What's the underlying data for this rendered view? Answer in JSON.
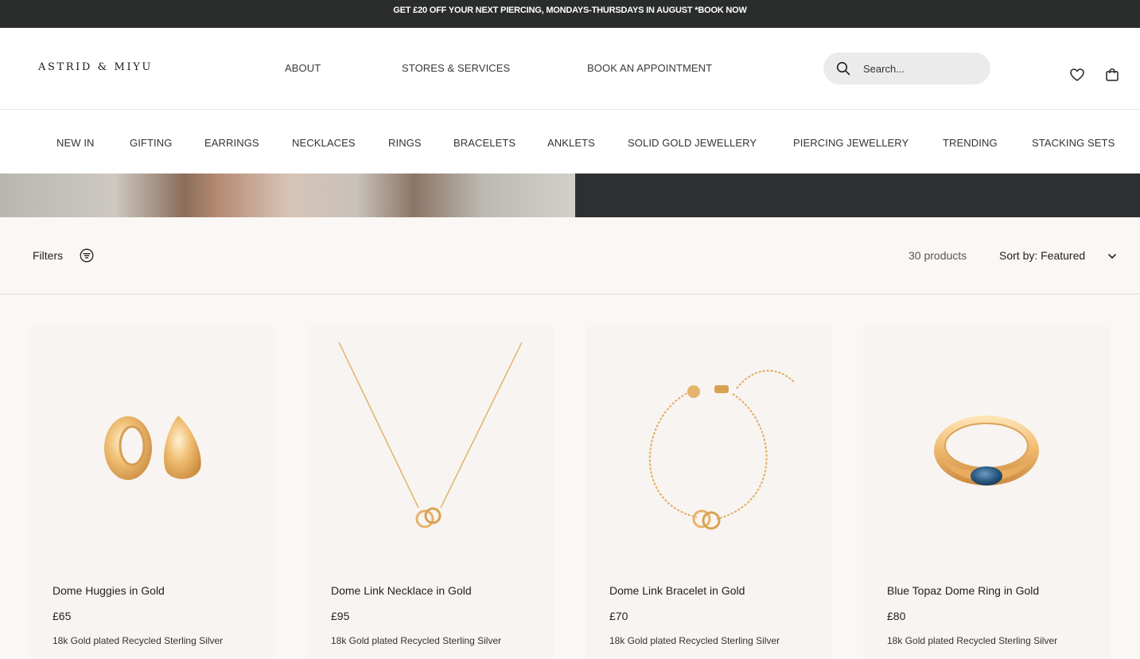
{
  "announcement": "GET £20 OFF YOUR NEXT PIERCING, MONDAYS-THURSDAYS IN AUGUST *BOOK NOW",
  "header": {
    "logo": "ASTRID & MIYU",
    "nav": [
      "ABOUT",
      "STORES & SERVICES",
      "BOOK AN APPOINTMENT"
    ],
    "search_placeholder": "Search..."
  },
  "categories": [
    "NEW IN",
    "GIFTING",
    "EARRINGS",
    "NECKLACES",
    "RINGS",
    "BRACELETS",
    "ANKLETS",
    "SOLID GOLD JEWELLERY",
    "PIERCING JEWELLERY",
    "TRENDING",
    "STACKING SETS"
  ],
  "toolbar": {
    "filters_label": "Filters",
    "product_count": "30 products",
    "sort_label": "Sort by: Featured"
  },
  "products": [
    {
      "name": "Dome Huggies in Gold",
      "price": "£65",
      "material": "18k Gold plated Recycled Sterling Silver"
    },
    {
      "name": "Dome Link Necklace in Gold",
      "price": "£95",
      "material": "18k Gold plated Recycled Sterling Silver"
    },
    {
      "name": "Dome Link Bracelet in Gold",
      "price": "£70",
      "material": "18k Gold plated Recycled Sterling Silver"
    },
    {
      "name": "Blue Topaz Dome Ring in Gold",
      "price": "£80",
      "material": "18k Gold plated Recycled Sterling Silver"
    }
  ],
  "colors": {
    "announcement_bg": "#2b2d2d",
    "gold": "#e5b36a",
    "card_bg": "#f8f4f1",
    "topaz": "#2d5e86"
  }
}
